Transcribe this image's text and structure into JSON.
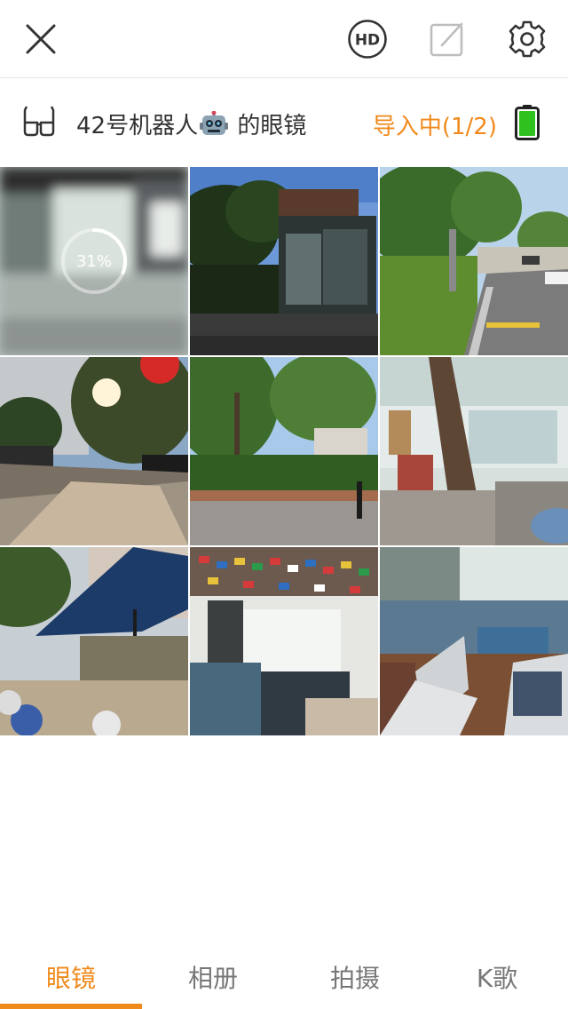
{
  "header": {
    "close_icon": "close-icon",
    "hd_label": "HD",
    "edit_icon": "edit-icon",
    "settings_icon": "gear-icon"
  },
  "device": {
    "name_before_emoji": "42号机器人",
    "name_emoji": "robot",
    "name_after_emoji": " 的眼镜",
    "import_status": "导入中(1/2)",
    "battery_color": "#2fc21f",
    "accent_color": "#f08a1c"
  },
  "gallery": {
    "photos": [
      {
        "progress": "31%",
        "progress_value": 0.31
      },
      {},
      {},
      {},
      {},
      {},
      {},
      {},
      {}
    ]
  },
  "tabs": [
    {
      "label": "眼镜",
      "active": true
    },
    {
      "label": "相册",
      "active": false
    },
    {
      "label": "拍摄",
      "active": false
    },
    {
      "label": "K歌",
      "active": false
    }
  ]
}
